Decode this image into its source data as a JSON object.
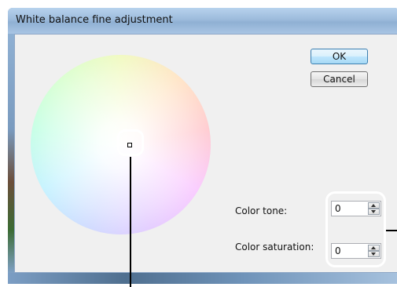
{
  "window": {
    "title": "White balance fine adjustment"
  },
  "buttons": {
    "ok_label": "OK",
    "cancel_label": "Cancel"
  },
  "fields": {
    "color_tone": {
      "label": "Color tone:",
      "value": "0"
    },
    "color_saturation": {
      "label": "Color saturation:",
      "value": "0"
    }
  },
  "color_wheel": {
    "marker": {
      "tone": 0,
      "saturation": 0
    }
  },
  "icons": [
    "spin-up-icon",
    "spin-down-icon"
  ],
  "colors": {
    "titlebar": "#9dbbdc",
    "client_bg": "#f0f0f0",
    "ok_button_border": "#3c7fb1",
    "callout_lines": "#000000",
    "highlight_ring": "#ffffff"
  }
}
